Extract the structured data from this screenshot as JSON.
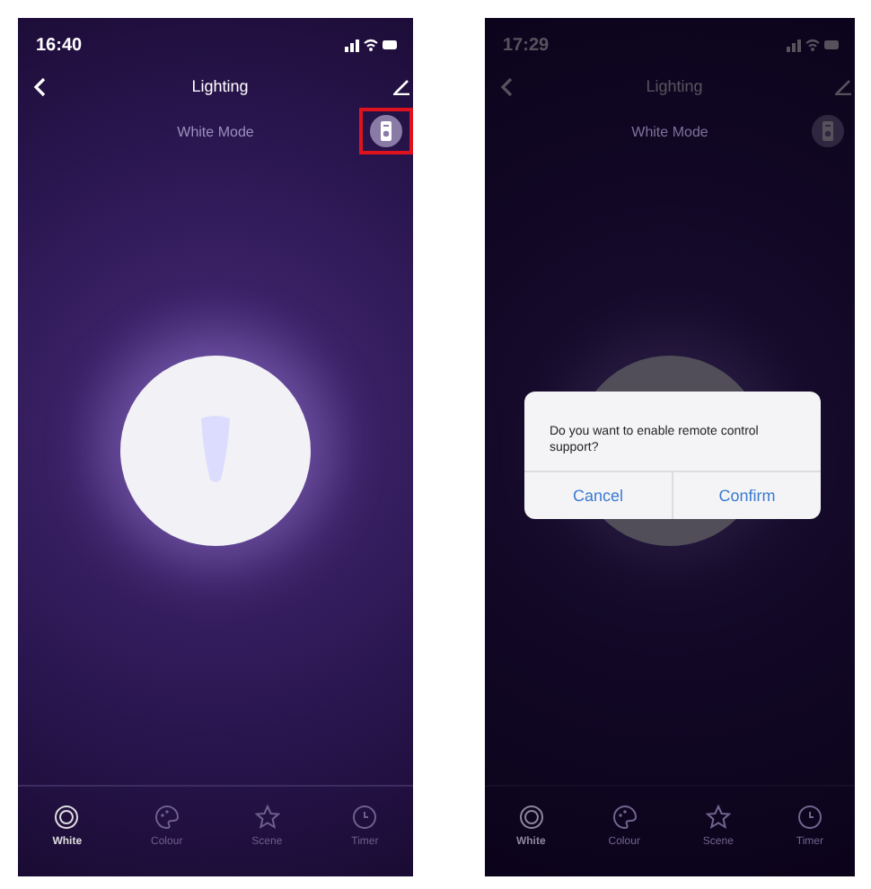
{
  "screens": [
    {
      "time": "16:40",
      "title": "Lighting",
      "subtitle": "White Mode",
      "remote_highlighted": true,
      "dimmed": false,
      "tabs": [
        {
          "label": "White",
          "kind": "ring",
          "selected": true
        },
        {
          "label": "Colour",
          "kind": "palette",
          "selected": false
        },
        {
          "label": "Scene",
          "kind": "star",
          "selected": false
        },
        {
          "label": "Timer",
          "kind": "clock",
          "selected": false
        }
      ]
    },
    {
      "time": "17:29",
      "title": "Lighting",
      "subtitle": "White Mode",
      "remote_highlighted": false,
      "dimmed": true,
      "tabs": [
        {
          "label": "White",
          "kind": "ring",
          "selected": true
        },
        {
          "label": "Colour",
          "kind": "palette",
          "selected": false
        },
        {
          "label": "Scene",
          "kind": "star",
          "selected": false
        },
        {
          "label": "Timer",
          "kind": "clock",
          "selected": false
        }
      ],
      "dialog": {
        "message": "Do you want to enable remote control support?",
        "buttons": [
          "Cancel",
          "Confirm"
        ]
      }
    }
  ]
}
